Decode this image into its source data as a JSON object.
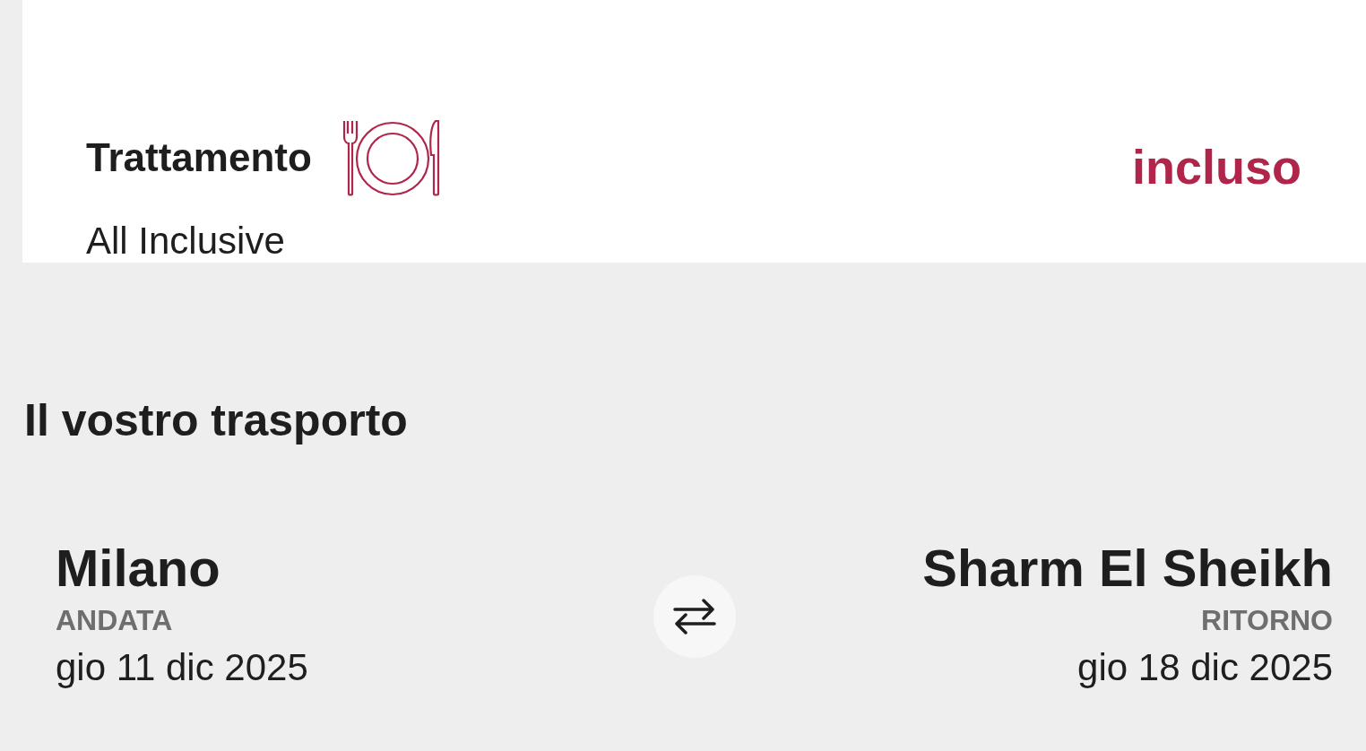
{
  "treatment": {
    "title": "Trattamento",
    "value": "All Inclusive",
    "price": "incluso"
  },
  "transport": {
    "title": "Il vostro trasporto",
    "legs": [
      {
        "city": "Milano",
        "label": "ANDATA",
        "date": "gio 11 dic 2025"
      },
      {
        "city": "Sharm El Sheikh",
        "label": "RITORNO",
        "date": "gio 18 dic 2025"
      }
    ]
  }
}
